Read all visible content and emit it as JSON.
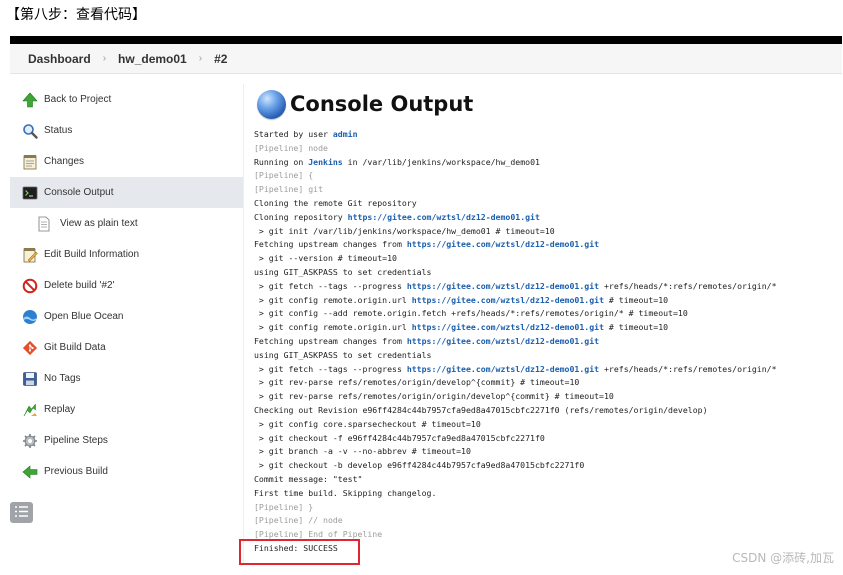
{
  "caption": "【第八步：查看代码】",
  "breadcrumb": [
    {
      "label": "Dashboard"
    },
    {
      "label": "hw_demo01"
    },
    {
      "label": "#2"
    }
  ],
  "sidebar": {
    "items": [
      {
        "label": "Back to Project",
        "icon": "up-arrow-icon"
      },
      {
        "label": "Status",
        "icon": "magnifier-icon"
      },
      {
        "label": "Changes",
        "icon": "notepad-icon"
      },
      {
        "label": "Console Output",
        "icon": "terminal-icon",
        "active": true
      },
      {
        "label": "View as plain text",
        "icon": "document-icon",
        "sub": true
      },
      {
        "label": "Edit Build Information",
        "icon": "notepad-pencil-icon"
      },
      {
        "label": "Delete build '#2'",
        "icon": "no-entry-icon"
      },
      {
        "label": "Open Blue Ocean",
        "icon": "blue-ocean-icon"
      },
      {
        "label": "Git Build Data",
        "icon": "git-icon"
      },
      {
        "label": "No Tags",
        "icon": "save-icon"
      },
      {
        "label": "Replay",
        "icon": "replay-arrow-icon"
      },
      {
        "label": "Pipeline Steps",
        "icon": "gear-icon"
      },
      {
        "label": "Previous Build",
        "icon": "left-arrow-icon"
      }
    ]
  },
  "page": {
    "title": "Console Output"
  },
  "console": {
    "lines": [
      [
        {
          "t": "Started by user "
        },
        {
          "t": "admin",
          "c": "lnk"
        }
      ],
      [
        {
          "t": "[Pipeline] node",
          "c": "pl"
        }
      ],
      [
        {
          "t": "Running on "
        },
        {
          "t": "Jenkins",
          "c": "lnk"
        },
        {
          "t": " in /var/lib/jenkins/workspace/hw_demo01"
        }
      ],
      [
        {
          "t": "[Pipeline] {",
          "c": "pl"
        }
      ],
      [
        {
          "t": "[Pipeline] git",
          "c": "pl"
        }
      ],
      [
        {
          "t": "Cloning the remote Git repository"
        }
      ],
      [
        {
          "t": "Cloning repository "
        },
        {
          "t": "https://gitee.com/wztsl/dz12-demo01.git",
          "c": "lnk"
        }
      ],
      [
        {
          "t": " > git init /var/lib/jenkins/workspace/hw_demo01 # timeout=10"
        }
      ],
      [
        {
          "t": "Fetching upstream changes from "
        },
        {
          "t": "https://gitee.com/wztsl/dz12-demo01.git",
          "c": "lnk"
        }
      ],
      [
        {
          "t": " > git --version # timeout=10"
        }
      ],
      [
        {
          "t": "using GIT_ASKPASS to set credentials"
        }
      ],
      [
        {
          "t": " > git fetch --tags --progress "
        },
        {
          "t": "https://gitee.com/wztsl/dz12-demo01.git",
          "c": "lnk"
        },
        {
          "t": " +refs/heads/*:refs/remotes/origin/*"
        }
      ],
      [
        {
          "t": " > git config remote.origin.url "
        },
        {
          "t": "https://gitee.com/wztsl/dz12-demo01.git",
          "c": "lnk"
        },
        {
          "t": " # timeout=10"
        }
      ],
      [
        {
          "t": " > git config --add remote.origin.fetch +refs/heads/*:refs/remotes/origin/* # timeout=10"
        }
      ],
      [
        {
          "t": " > git config remote.origin.url "
        },
        {
          "t": "https://gitee.com/wztsl/dz12-demo01.git",
          "c": "lnk"
        },
        {
          "t": " # timeout=10"
        }
      ],
      [
        {
          "t": "Fetching upstream changes from "
        },
        {
          "t": "https://gitee.com/wztsl/dz12-demo01.git",
          "c": "lnk"
        }
      ],
      [
        {
          "t": "using GIT_ASKPASS to set credentials"
        }
      ],
      [
        {
          "t": " > git fetch --tags --progress "
        },
        {
          "t": "https://gitee.com/wztsl/dz12-demo01.git",
          "c": "lnk"
        },
        {
          "t": " +refs/heads/*:refs/remotes/origin/*"
        }
      ],
      [
        {
          "t": " > git rev-parse refs/remotes/origin/develop^{commit} # timeout=10"
        }
      ],
      [
        {
          "t": " > git rev-parse refs/remotes/origin/origin/develop^{commit} # timeout=10"
        }
      ],
      [
        {
          "t": "Checking out Revision e96ff4284c44b7957cfa9ed8a47015cbfc2271f0 (refs/remotes/origin/develop)"
        }
      ],
      [
        {
          "t": " > git config core.sparsecheckout # timeout=10"
        }
      ],
      [
        {
          "t": " > git checkout -f e96ff4284c44b7957cfa9ed8a47015cbfc2271f0"
        }
      ],
      [
        {
          "t": " > git branch -a -v --no-abbrev # timeout=10"
        }
      ],
      [
        {
          "t": " > git checkout -b develop e96ff4284c44b7957cfa9ed8a47015cbfc2271f0"
        }
      ],
      [
        {
          "t": "Commit message: \"test\""
        }
      ],
      [
        {
          "t": "First time build. Skipping changelog."
        }
      ],
      [
        {
          "t": "[Pipeline] }",
          "c": "pl"
        }
      ],
      [
        {
          "t": "[Pipeline] // node",
          "c": "pl"
        }
      ],
      [
        {
          "t": "[Pipeline] End of Pipeline",
          "c": "pl"
        }
      ],
      [
        {
          "t": "Finished: SUCCESS"
        }
      ]
    ]
  },
  "watermark": "CSDN @添砖,加瓦",
  "colors": {
    "link": "#1b5fae",
    "highlight_box": "#e0262e",
    "active_bg": "#e5e9ee"
  }
}
